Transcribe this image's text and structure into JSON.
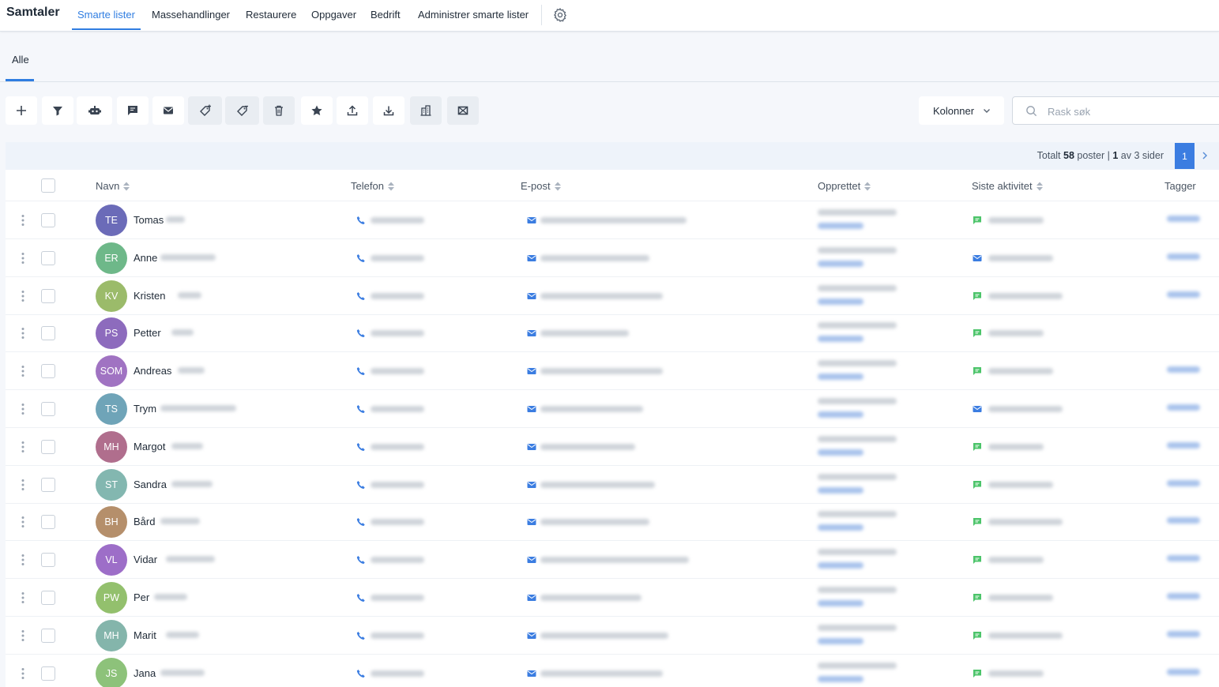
{
  "nav": {
    "brand": "Samtaler",
    "items": [
      "Smarte lister",
      "Massehandlinger",
      "Restaurere",
      "Oppgaver",
      "Bedrift",
      "Administrer smarte lister"
    ],
    "active_index": 0
  },
  "tabs": {
    "items": [
      "Alle"
    ]
  },
  "toolbar": {
    "buttons": [
      "add-icon",
      "filter-icon",
      "robot-icon",
      "chat-icon",
      "mail-icon",
      "tag-add-icon",
      "tag-remove-icon",
      "trash-icon",
      "star-icon",
      "upload-icon",
      "download-icon",
      "building-icon",
      "merge-icon"
    ],
    "columns_label": "Kolonner",
    "search_placeholder": "Rask søk"
  },
  "pager": {
    "prefix": "Totalt",
    "total": "58",
    "unit": "poster |",
    "page": "1",
    "of_text": "av 3 sider",
    "current_page": "1"
  },
  "table": {
    "headers": {
      "name": "Navn",
      "phone": "Telefon",
      "email": "E-post",
      "created": "Opprettet",
      "last_activity": "Siste aktivitet",
      "tags": "Tagger"
    },
    "rows": [
      {
        "initials": "TE",
        "name": "Tomas",
        "color": "#6b6bb8",
        "activity": "chat"
      },
      {
        "initials": "ER",
        "name": "Anne",
        "color": "#6eb889",
        "activity": "mail"
      },
      {
        "initials": "KV",
        "name": "Kristen",
        "color": "#9bbb6a",
        "activity": "chat"
      },
      {
        "initials": "PS",
        "name": "Petter",
        "color": "#8d6bbd",
        "activity": "chat"
      },
      {
        "initials": "SOM",
        "name": "Andreas",
        "color": "#a073c2",
        "activity": "chat"
      },
      {
        "initials": "TS",
        "name": "Trym",
        "color": "#6fa4b8",
        "activity": "mail"
      },
      {
        "initials": "MH",
        "name": "Margot",
        "color": "#b06e8d",
        "activity": "chat"
      },
      {
        "initials": "ST",
        "name": "Sandra",
        "color": "#83b7b0",
        "activity": "chat"
      },
      {
        "initials": "BH",
        "name": "Bård",
        "color": "#b58f6b",
        "activity": "chat"
      },
      {
        "initials": "VL",
        "name": "Vidar",
        "color": "#9d6ec8",
        "activity": "chat"
      },
      {
        "initials": "PW",
        "name": "Per",
        "color": "#93c06d",
        "activity": "chat"
      },
      {
        "initials": "MH",
        "name": "Marit",
        "color": "#84b5ab",
        "activity": "chat"
      },
      {
        "initials": "JS",
        "name": "Jana",
        "color": "#8dc27a",
        "activity": "chat"
      }
    ]
  },
  "colors": {
    "accent": "#2f7de1",
    "chat_icon": "#4cc46a",
    "mail_icon": "#3b7de1"
  }
}
